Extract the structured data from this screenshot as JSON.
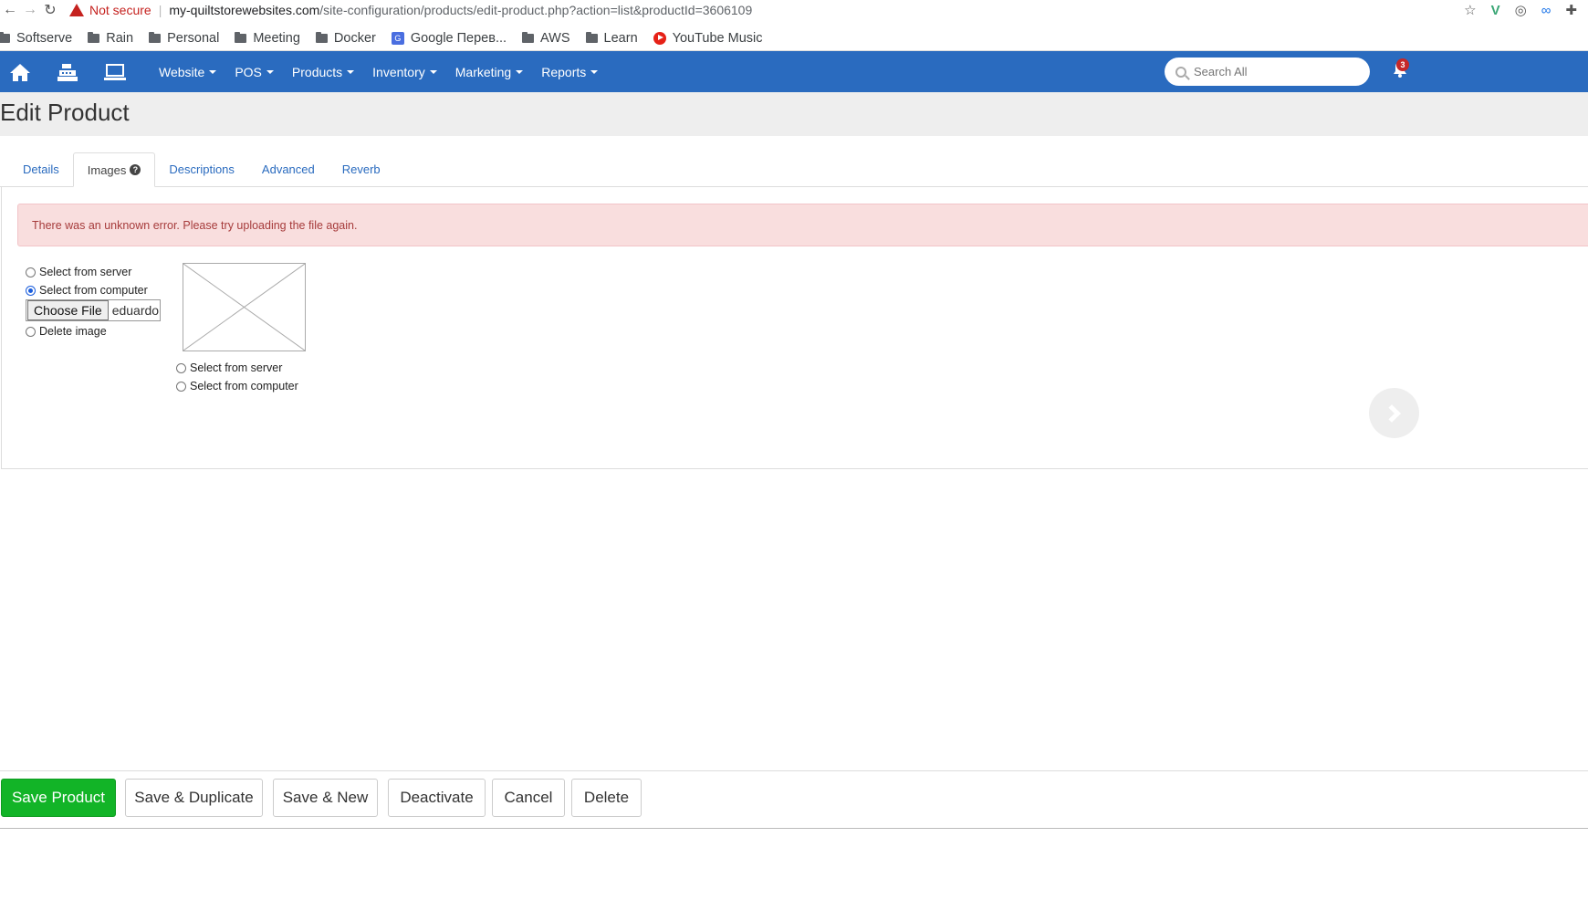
{
  "browser": {
    "security_label": "Not secure",
    "url_host": "my-quiltstorewebsites.com",
    "url_path": "/site-configuration/products/edit-product.php?action=list&productId=3606109",
    "bookmarks": [
      "Softserve",
      "Rain",
      "Personal",
      "Meeting",
      "Docker",
      "Google Перев...",
      "AWS",
      "Learn",
      "YouTube Music"
    ]
  },
  "nav": {
    "menu": [
      "Website",
      "POS",
      "Products",
      "Inventory",
      "Marketing",
      "Reports"
    ],
    "search_placeholder": "Search All",
    "notification_count": "3",
    "color": "#2a6bbf"
  },
  "page": {
    "title": "Edit Product"
  },
  "tabs": [
    "Details",
    "Images",
    "Descriptions",
    "Advanced",
    "Reverb"
  ],
  "active_tab": "Images",
  "alert": {
    "message": "There was an unknown error. Please try uploading the file again."
  },
  "image_slot_1": {
    "option_server": "Select from server",
    "option_computer": "Select from computer",
    "option_delete": "Delete image",
    "selected": "Select from computer",
    "file_button": "Choose File",
    "file_name": "eduardo"
  },
  "image_slot_2": {
    "option_server": "Select from server",
    "option_computer": "Select from computer"
  },
  "actions": {
    "save": "Save Product",
    "save_duplicate": "Save & Duplicate",
    "save_new": "Save & New",
    "deactivate": "Deactivate",
    "cancel": "Cancel",
    "delete": "Delete"
  }
}
